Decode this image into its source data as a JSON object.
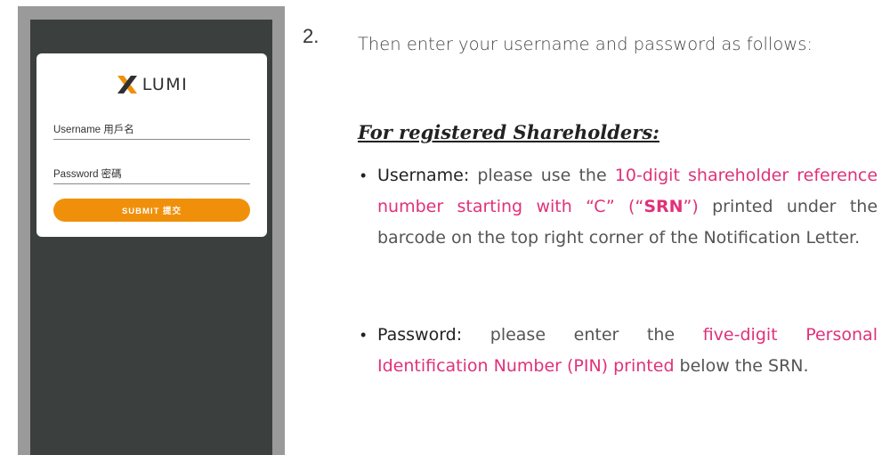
{
  "phone": {
    "logo_text": "LUMI",
    "username_label": "Username 用戶名",
    "password_label": "Password 密碼",
    "submit_label": "SUBMIT 提交",
    "accent_color": "#f0900a"
  },
  "instructions": {
    "step_number": "2.",
    "intro": "Then enter your username and password as follows:",
    "section_heading": "For registered Shareholders:",
    "username_item": {
      "label": "Username:",
      "text1": " please use the ",
      "highlight1": "10-digit shareholder reference number starting with “C” (“",
      "highlight_bold": "SRN",
      "highlight2": "”)",
      "text2": " printed under the barcode on the top right corner of the Notification Letter."
    },
    "password_item": {
      "label": "Password:",
      "text1": " please enter the ",
      "highlight": "five-digit Personal Identification Number (PIN) printed",
      "text2": " below the SRN."
    },
    "highlight_color": "#e0317a"
  }
}
